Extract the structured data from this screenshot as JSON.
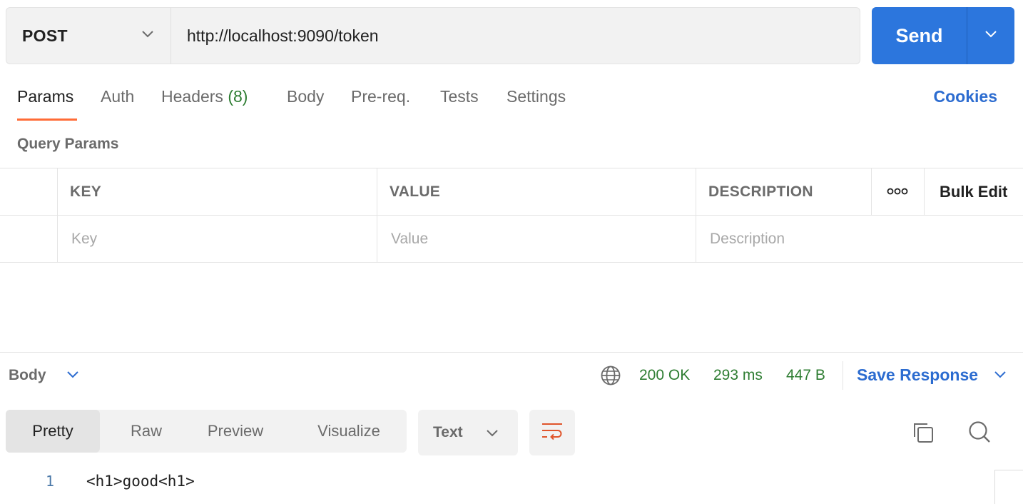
{
  "request": {
    "method": "POST",
    "url": "http://localhost:9090/token",
    "send_label": "Send"
  },
  "tabs": {
    "params": "Params",
    "auth": "Auth",
    "headers": "Headers",
    "headers_count": "(8)",
    "body": "Body",
    "prereq": "Pre-req.",
    "tests": "Tests",
    "settings": "Settings",
    "cookies": "Cookies"
  },
  "query_params": {
    "title": "Query Params",
    "columns": {
      "key": "KEY",
      "value": "VALUE",
      "description": "DESCRIPTION",
      "bulk_edit": "Bulk Edit"
    },
    "placeholders": {
      "key": "Key",
      "value": "Value",
      "description": "Description"
    }
  },
  "response": {
    "body_label": "Body",
    "status": "200 OK",
    "time": "293 ms",
    "size": "447 B",
    "save_label": "Save Response",
    "view_tabs": [
      "Pretty",
      "Raw",
      "Preview",
      "Visualize"
    ],
    "format": "Text",
    "lines": [
      {
        "num": "1",
        "code": "<h1>good<h1>"
      }
    ]
  },
  "icons": {
    "method_dropdown": "chevron-down-icon",
    "send_dropdown": "chevron-down-icon",
    "more": "more-horizontal-icon",
    "globe": "globe-icon",
    "wrap": "word-wrap-icon",
    "copy": "copy-icon",
    "search": "search-icon"
  },
  "colors": {
    "accent": "#2c76dd",
    "link": "#2c6cd0",
    "active_tab_underline": "#ff6c37",
    "success": "#2e7d32",
    "wrap_icon": "#e0552b"
  }
}
